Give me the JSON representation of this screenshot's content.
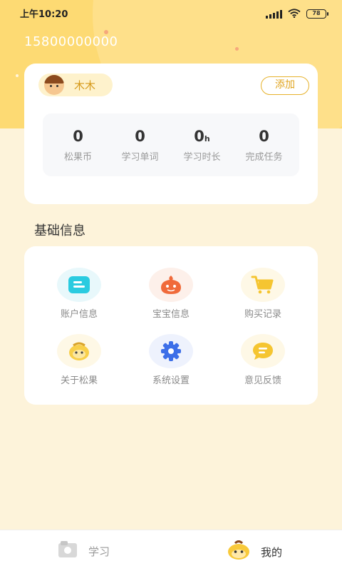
{
  "status_bar": {
    "time": "上午10:20",
    "battery": "78",
    "signal_icon": "signal-icon",
    "wifi_icon": "wifi-icon"
  },
  "profile": {
    "phone": "15800000000"
  },
  "child": {
    "name": "木木",
    "add_label": "添加"
  },
  "stats": [
    {
      "value": "0",
      "unit": "",
      "label": "松果币"
    },
    {
      "value": "0",
      "unit": "",
      "label": "学习单词"
    },
    {
      "value": "0",
      "unit": "h",
      "label": "学习时长"
    },
    {
      "value": "0",
      "unit": "",
      "label": "完成任务"
    }
  ],
  "section": {
    "title": "基础信息"
  },
  "menu": [
    {
      "label": "账户信息",
      "icon": "account-card-icon"
    },
    {
      "label": "宝宝信息",
      "icon": "baby-icon"
    },
    {
      "label": "购买记录",
      "icon": "cart-icon"
    },
    {
      "label": "关于松果",
      "icon": "pinecone-mascot-icon"
    },
    {
      "label": "系统设置",
      "icon": "gear-icon"
    },
    {
      "label": "意见反馈",
      "icon": "feedback-chat-icon"
    }
  ],
  "tabs": [
    {
      "label": "学习",
      "icon": "study-icon"
    },
    {
      "label": "我的",
      "icon": "mascot-icon"
    }
  ],
  "colors": {
    "header_bg": "#FDDA73",
    "page_bg": "#FDF3DA",
    "accent": "#E6B22C",
    "account_icon": "#2ACBE0",
    "baby_icon": "#F06A3A",
    "cart_icon": "#F5C531",
    "settings_icon": "#3D6FE8",
    "feedback_icon": "#F5C531"
  }
}
